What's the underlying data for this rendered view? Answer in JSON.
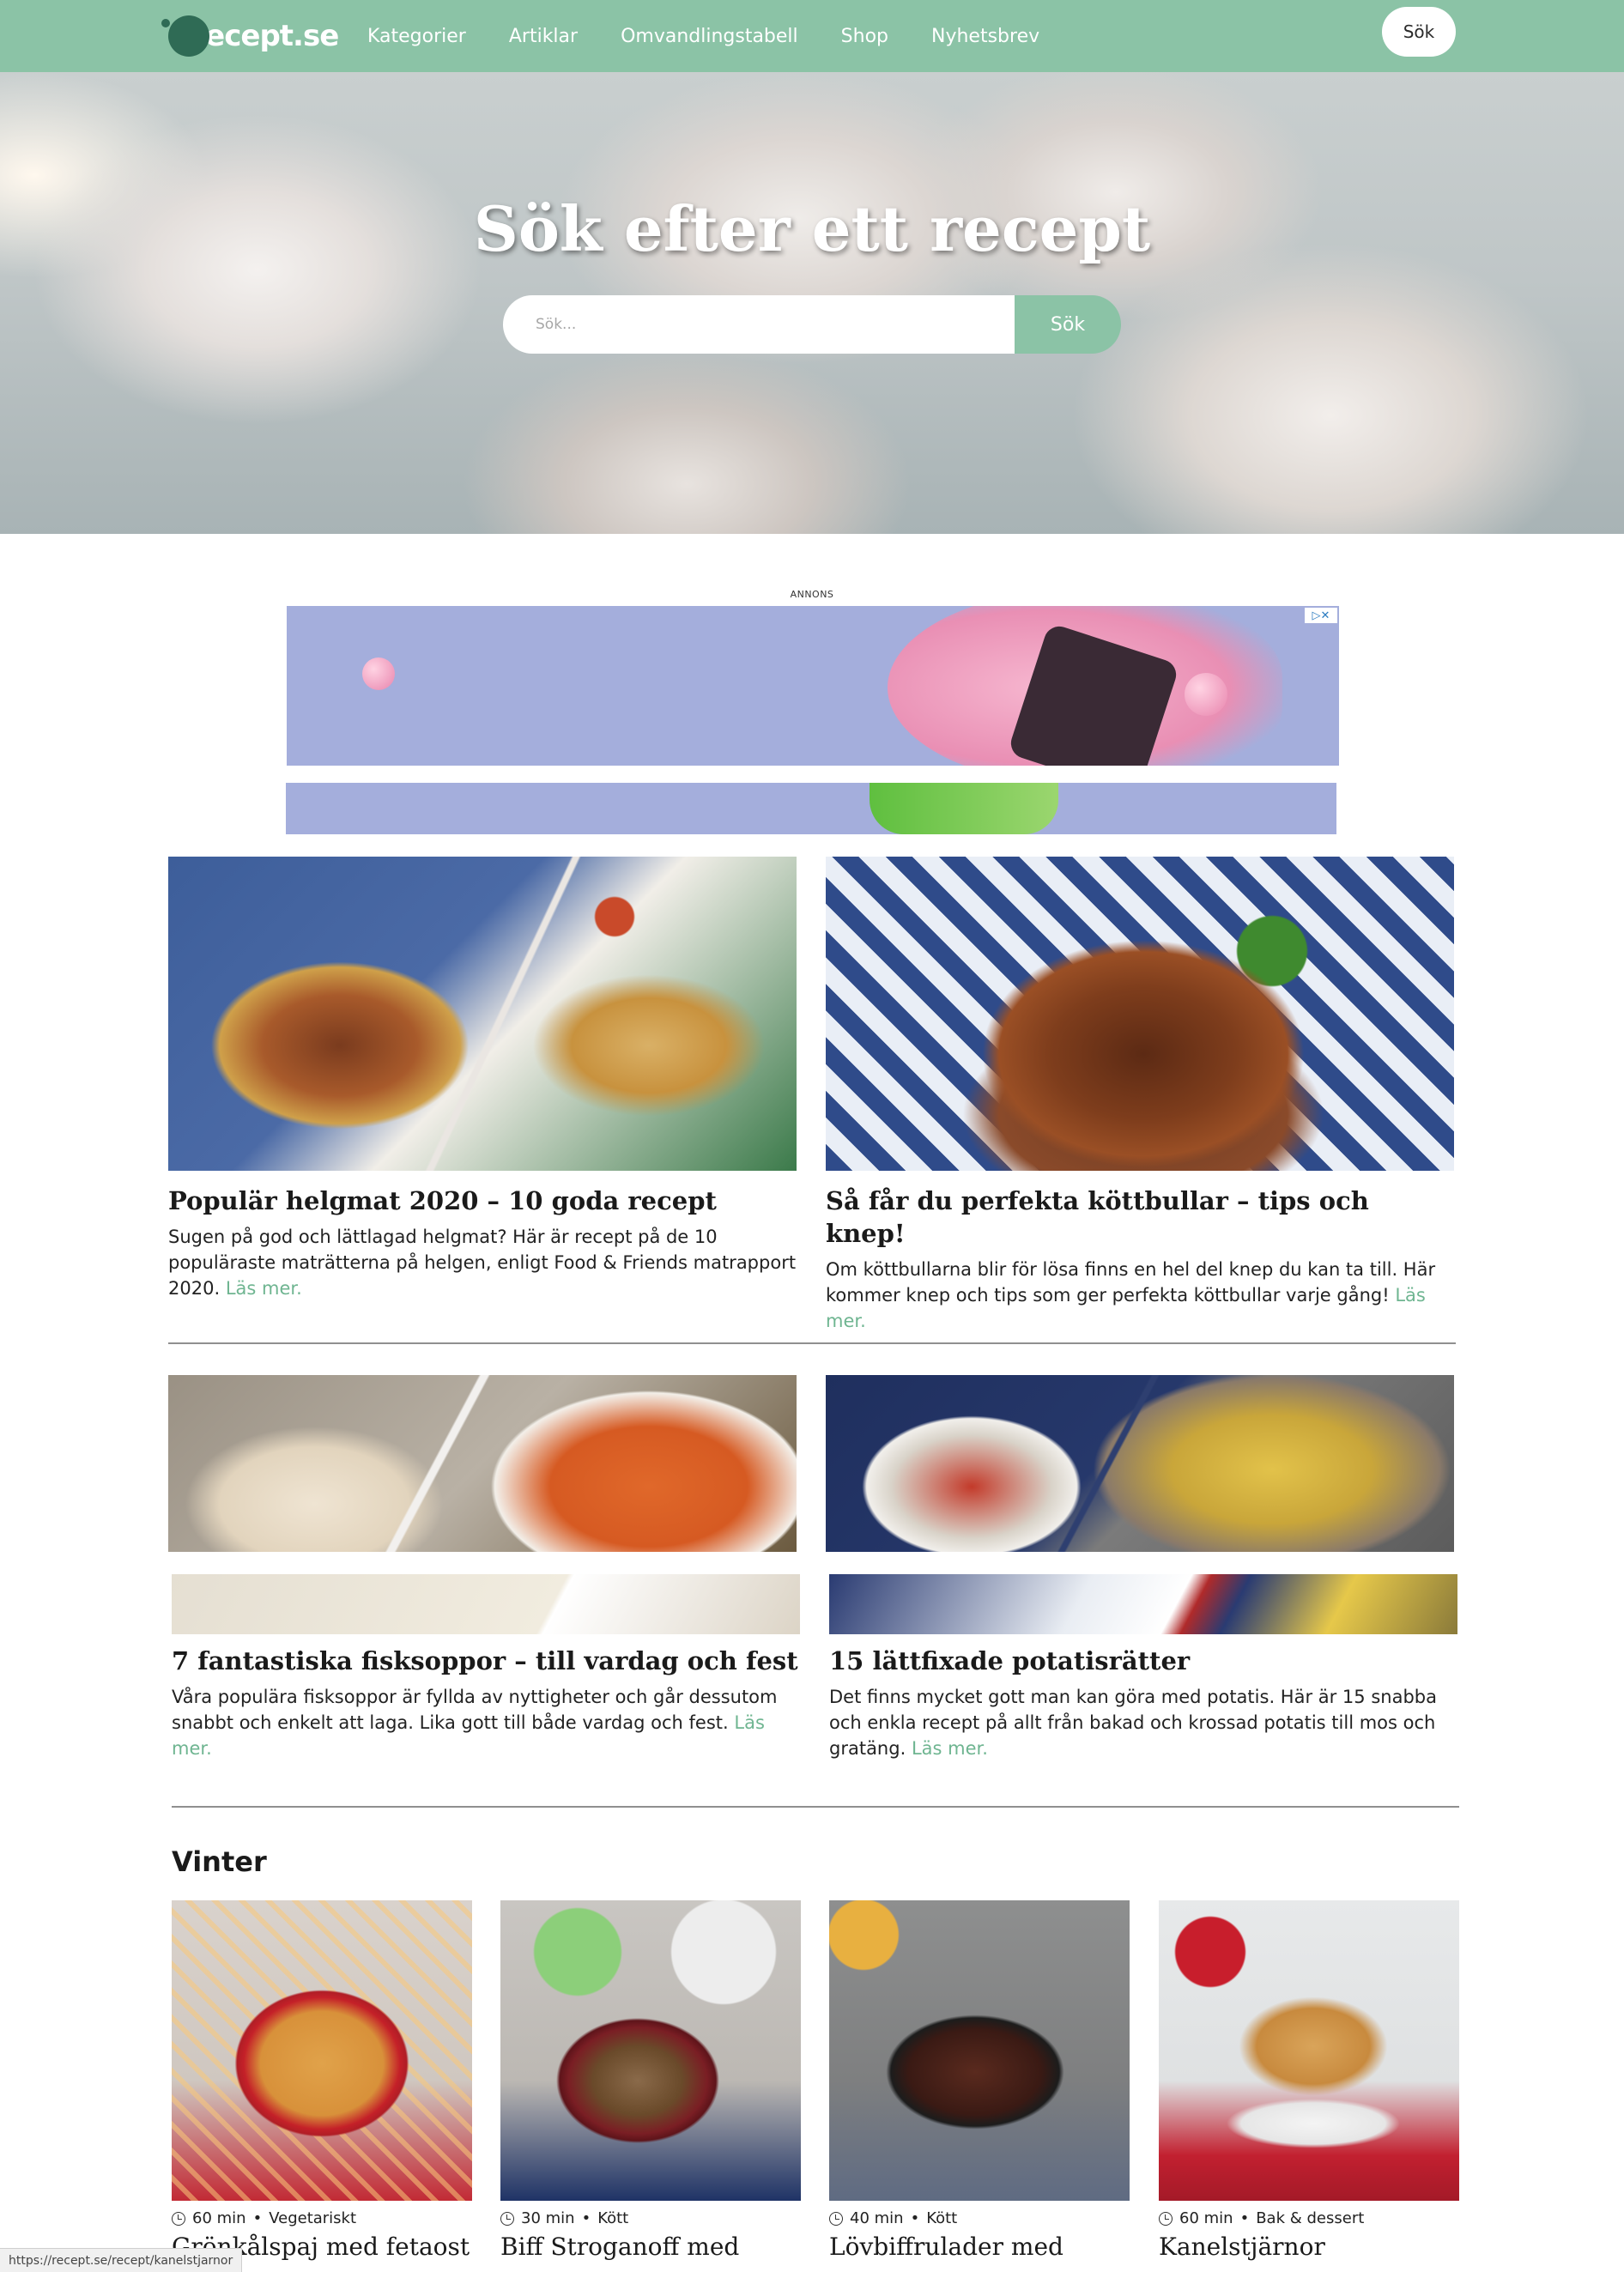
{
  "nav": {
    "logo": "Recept.se",
    "links": [
      "Kategorier",
      "Artiklar",
      "Omvandlingstabell",
      "Shop",
      "Nyhetsbrev"
    ],
    "search_button": "Sök"
  },
  "hero": {
    "title": "Sök efter ett recept",
    "search_placeholder": "Sök...",
    "search_button": "Sök"
  },
  "ad": {
    "label": "ANNONS",
    "close_icons": "▷✕"
  },
  "features": [
    {
      "title": "Populär helgmat 2020 – 10 goda recept",
      "description": "Sugen på god och lättlagad helgmat? Här är recept på de 10 populäraste maträtterna på helgen, enligt Food & Friends matrapport 2020.",
      "more": "Läs mer."
    },
    {
      "title": "Så får du perfekta köttbullar – tips och knep!",
      "description": "Om köttbullarna blir för lösa finns en hel del knep du kan ta till. Här kommer knep och tips som ger perfekta köttbullar varje gång!",
      "more": "Läs mer."
    },
    {
      "title": "7 fantastiska fisksoppor – till vardag och fest",
      "description": "Våra populära fisksoppor är fyllda av nyttigheter och går dessutom snabbt och enkelt att laga. Lika gott till både vardag och fest.",
      "more": "Läs mer."
    },
    {
      "title": "15 lättfixade potatisrätter",
      "description": "Det finns mycket gott man kan göra med potatis. Här är 15 snabba och enkla recept på allt från bakad och krossad potatis till mos och gratäng.",
      "more": "Läs mer."
    }
  ],
  "section": {
    "title": "Vinter",
    "recipes": [
      {
        "time": "60 min",
        "category": "Vegetariskt",
        "title": "Grönkålspaj med fetaost"
      },
      {
        "time": "30 min",
        "category": "Kött",
        "title": "Biff Stroganoff med"
      },
      {
        "time": "40 min",
        "category": "Kött",
        "title": "Lövbiffrulader med"
      },
      {
        "time": "60 min",
        "category": "Bak & dessert",
        "title": "Kanelstjärnor"
      }
    ],
    "separator": "•"
  },
  "status_url": "https://recept.se/recept/kanelstjarnor"
}
